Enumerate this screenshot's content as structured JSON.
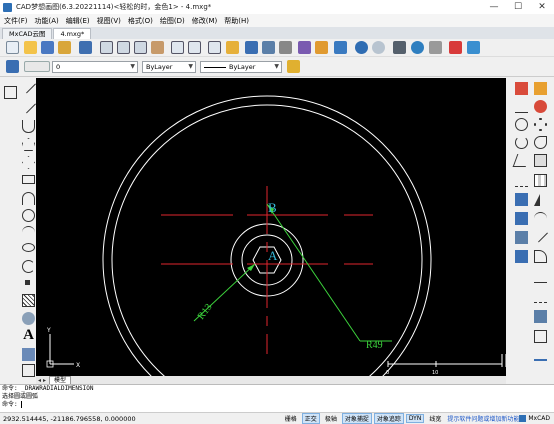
{
  "app": {
    "title": "CAD梦想画图(6.3.20221114)<轻松的时，金色1> - 4.mxg*",
    "window_buttons": {
      "minimize": "—",
      "maximize": "☐",
      "close": "✕"
    }
  },
  "menu": [
    "文件(F)",
    "功能(A)",
    "编辑(E)",
    "视图(V)",
    "格式(O)",
    "绘图(D)",
    "修改(M)",
    "帮助(H)"
  ],
  "tabs": [
    {
      "label": "MxCAD云图"
    },
    {
      "label": "4.mxg*"
    }
  ],
  "properties": {
    "layer_value": "0",
    "color_value": "ByLayer",
    "linetype_value": "ByLayer"
  },
  "drawing": {
    "label_b": "B",
    "label_a": "A",
    "dim_r13": "R13",
    "dim_r49": "R49",
    "ucs_y": "Y",
    "ucs_x": "X",
    "scale_0": "0",
    "scale_10": "10"
  },
  "model_tab": "模型",
  "command": {
    "line1": "命令: _DRAWRADIALDIMENSION",
    "line2": "选择圆或圆弧",
    "prompt": "命令:",
    "input": ""
  },
  "status": {
    "coordinates": "2932.514445, -21186.796558, 0.000000",
    "buttons": [
      {
        "label": "栅格",
        "on": false
      },
      {
        "label": "正交",
        "on": true
      },
      {
        "label": "极轴",
        "on": false
      },
      {
        "label": "对象捕捉",
        "on": true
      },
      {
        "label": "对象追踪",
        "on": true
      },
      {
        "label": "DYN",
        "on": true
      },
      {
        "label": "线宽",
        "on": false
      }
    ],
    "promo_link": "提示软件问题或增加新功能",
    "brand": "MxCAD"
  },
  "colors": {
    "accent_blue": "#2d6fb5",
    "geometry_white": "#ffffff",
    "centerline_red": "#e0262e",
    "dimension_green": "#3cd23c",
    "label_cyan": "#36b8d8"
  }
}
